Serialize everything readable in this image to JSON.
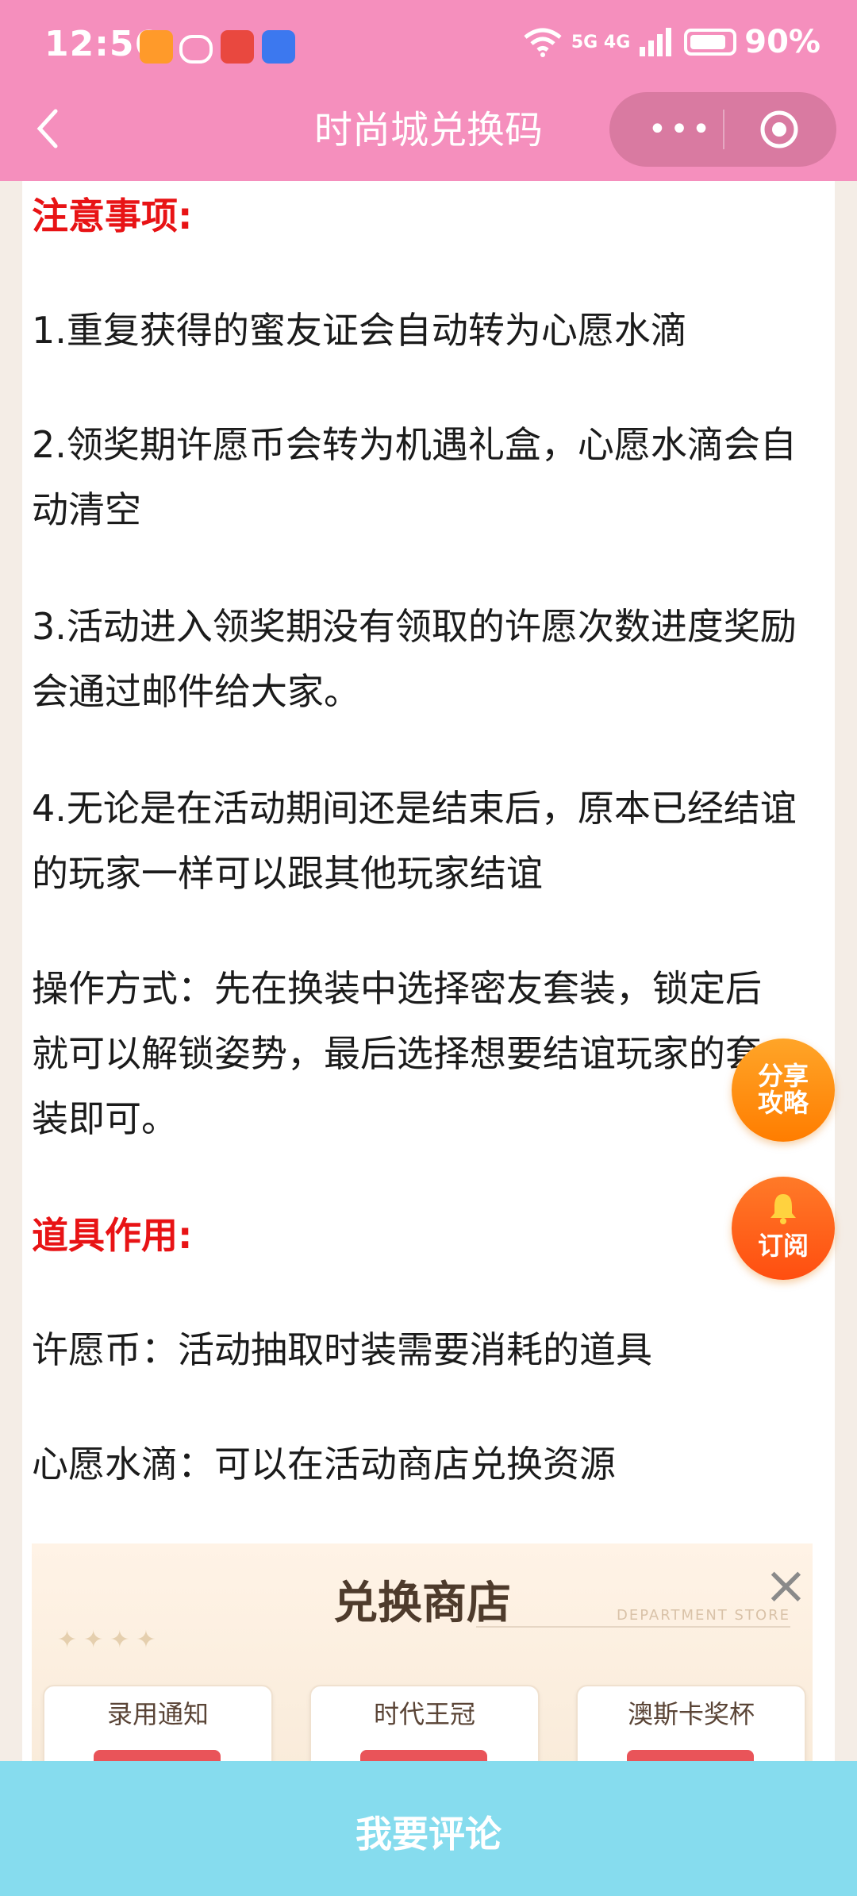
{
  "status_bar": {
    "time": "12:56",
    "battery": "90%",
    "network": "5G 4G",
    "icons": [
      "taobao-heart-icon",
      "chat-bubble-icon",
      "mascot-618-icon",
      "blue-app-icon",
      "wifi-icon",
      "signal-icon",
      "battery-icon"
    ]
  },
  "nav": {
    "title": "时尚城兑换码",
    "more_glyph": "•••"
  },
  "article": {
    "notice_heading": "注意事项:",
    "items": [
      "1.重复获得的蜜友证会自动转为心愿水滴",
      "2.领奖期许愿币会转为机遇礼盒，心愿水滴会自动清空",
      "3.活动进入领奖期没有领取的许愿次数进度奖励会通过邮件给大家。",
      "4.无论是在活动期间还是结束后，原本已经结谊的玩家一样可以跟其他玩家结谊",
      "操作方式：先在换装中选择密友套装，锁定后就可以解锁姿势，最后选择想要结谊玩家的套装即可。"
    ],
    "props_heading": "道具作用:",
    "props": [
      "许愿币：活动抽取时装需要消耗的道具",
      "心愿水滴：可以在活动商店兑换资源"
    ]
  },
  "shop_image": {
    "title": "兑换商店",
    "subtitle": "DEPARTMENT STORE",
    "close": "×",
    "items": [
      "录用通知",
      "时代王冠",
      "澳斯卡奖杯"
    ]
  },
  "fabs": {
    "share_line1": "分享",
    "share_line2": "攻略",
    "subscribe": "订阅"
  },
  "bottom": {
    "comment_label": "我要评论"
  },
  "colors": {
    "nav_bg": "#f58fbd",
    "heading_red": "#e81315",
    "bottom_bar": "#86dcee",
    "fab_orange": "#ff8c00"
  }
}
